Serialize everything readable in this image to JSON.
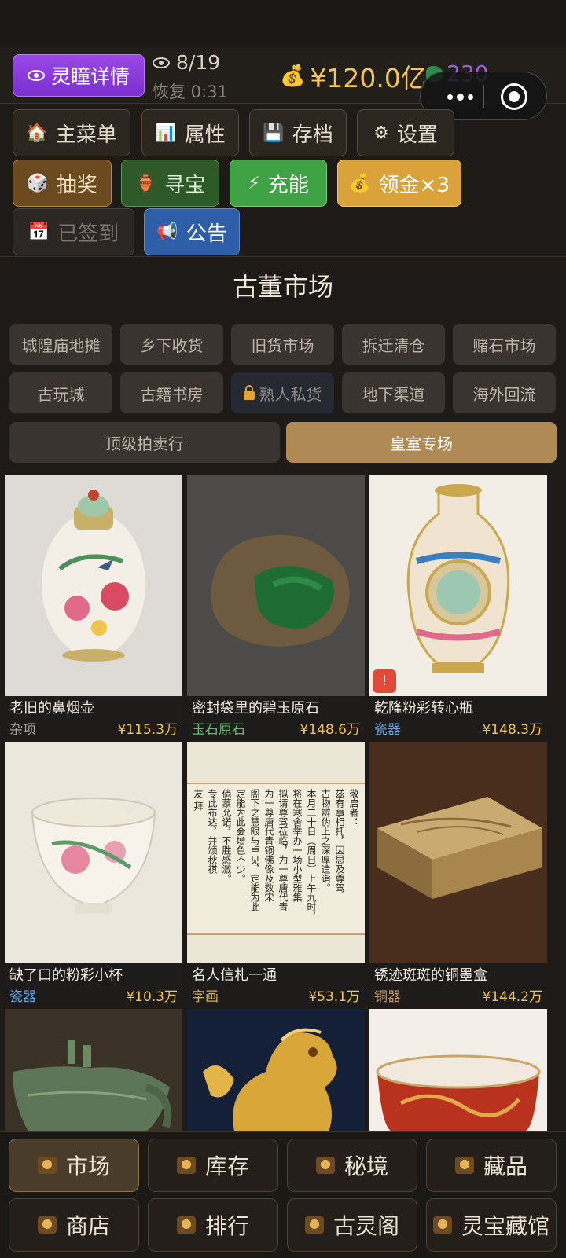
{
  "header": {
    "lingtong_label": "灵瞳详情",
    "vision_count": "8/19",
    "recover_label": "恢复 0:31",
    "money": "¥120.0亿",
    "jade": "230"
  },
  "actions": {
    "main_menu": "主菜单",
    "attributes": "属性",
    "save": "存档",
    "settings": "设置",
    "lottery": "抽奖",
    "treasure_hunt": "寻宝",
    "charge": "充能",
    "claim_gold": "领金×3",
    "checked_in": "已签到",
    "notice": "公告"
  },
  "market": {
    "title": "古董市场",
    "locations": [
      "城隍庙地摊",
      "乡下收货",
      "旧货市场",
      "拆迁清仓",
      "赌石市场",
      "古玩城",
      "古籍书房",
      "熟人私货",
      "地下渠道",
      "海外回流"
    ],
    "locked_location_index": 7,
    "wide_tabs": [
      "顶级拍卖行",
      "皇室专场"
    ],
    "active_tab": "皇室专场"
  },
  "items": [
    {
      "name": "老旧的鼻烟壶",
      "category": "杂项",
      "price": "¥115.3万"
    },
    {
      "name": "密封袋里的碧玉原石",
      "category": "玉石原石",
      "price": "¥148.6万"
    },
    {
      "name": "乾隆粉彩转心瓶",
      "category": "瓷器",
      "price": "¥148.3万",
      "warning": "!"
    },
    {
      "name": "缺了口的粉彩小杯",
      "category": "瓷器",
      "price": "¥10.3万"
    },
    {
      "name": "名人信札一通",
      "category": "字画",
      "price": "¥53.1万"
    },
    {
      "name": "锈迹斑斑的铜墨盒",
      "category": "铜器",
      "price": "¥144.2万"
    }
  ],
  "letter_text": [
    "敬启者：",
    "兹有事相托，因思及尊驾",
    "古物辨伪上之深厚造诣。",
    "本月二十日（周日）上午九时，",
    "将在寒舍举办一场小型雅集",
    "拟请尊驾莅临，为一尊唐代青",
    "为一尊唐代青铜佛像及数宋",
    "阁下之慧眼与卓见，定能为此",
    "定能为此会增色不少。",
    "倘蒙允诺，不胜感激。",
    "专此布达，并颂秋祺",
    "友 拜"
  ],
  "nav": [
    "市场",
    "库存",
    "秘境",
    "藏品",
    "商店",
    "排行",
    "古灵阁",
    "灵宝藏馆"
  ],
  "active_nav": "市场",
  "colors": {
    "accent_gold": "#b08a55",
    "price": "#f3c45a",
    "purple": "#8e3fdf"
  }
}
